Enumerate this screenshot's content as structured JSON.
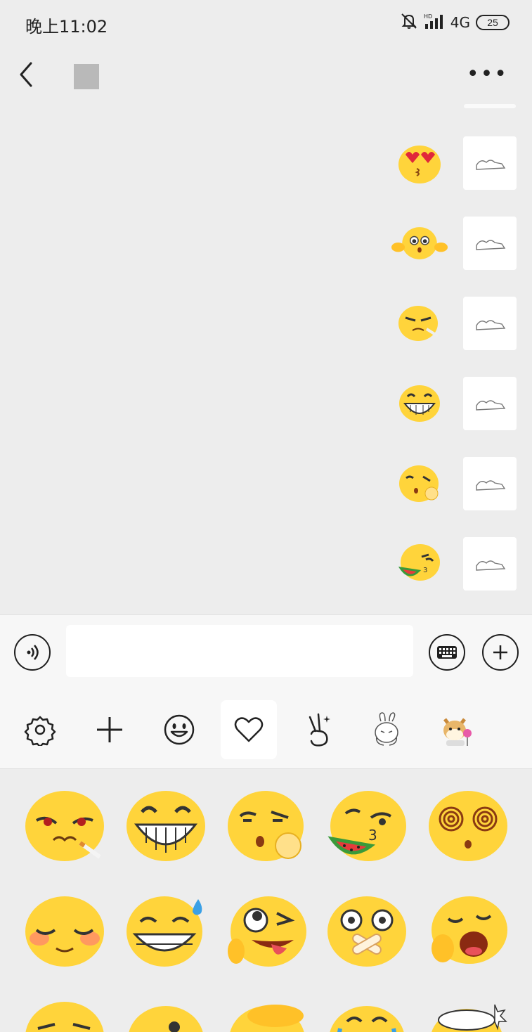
{
  "status_bar": {
    "time": "晚上11:02",
    "network": "4G",
    "battery": "25",
    "icons": [
      "bell-off-icon",
      "signal-icon"
    ]
  },
  "nav": {
    "back_icon": "chevron-left-icon",
    "more_label": "•••"
  },
  "chat": {
    "messages": [
      {
        "emoji": "heart-eyes-kiss-emoji"
      },
      {
        "emoji": "hug-emoji"
      },
      {
        "emoji": "smoking-emoji"
      },
      {
        "emoji": "grin-emoji"
      },
      {
        "emoji": "thinking-emoji"
      },
      {
        "emoji": "eating-watermelon-emoji"
      }
    ]
  },
  "input_bar": {
    "voice_icon": "voice-icon",
    "keyboard_icon": "keyboard-icon",
    "plus_icon": "plus-circle-icon",
    "placeholder": ""
  },
  "emoji_tabs": [
    "settings-icon",
    "add-icon",
    "smiley-icon",
    "heart-icon",
    "victory-hand-icon",
    "rabbit-sticker-icon",
    "doge-sticker-icon"
  ],
  "emoji_grid": [
    "smoking-emoji",
    "grin-emoji",
    "thinking-emoji",
    "eating-watermelon-emoji",
    "dizzy-emoji",
    "shy-emoji",
    "sweat-grin-emoji",
    "tongue-wink-emoji",
    "sealed-lips-emoji",
    "yawn-emoji",
    "smirk-emoji",
    "peek-emoji",
    "facepalm-emoji",
    "cry-emoji",
    "fireworks-emoji"
  ],
  "colors": {
    "emoji_yellow": "#ffd43b",
    "bg": "#ededed",
    "panel": "#f7f7f7"
  }
}
